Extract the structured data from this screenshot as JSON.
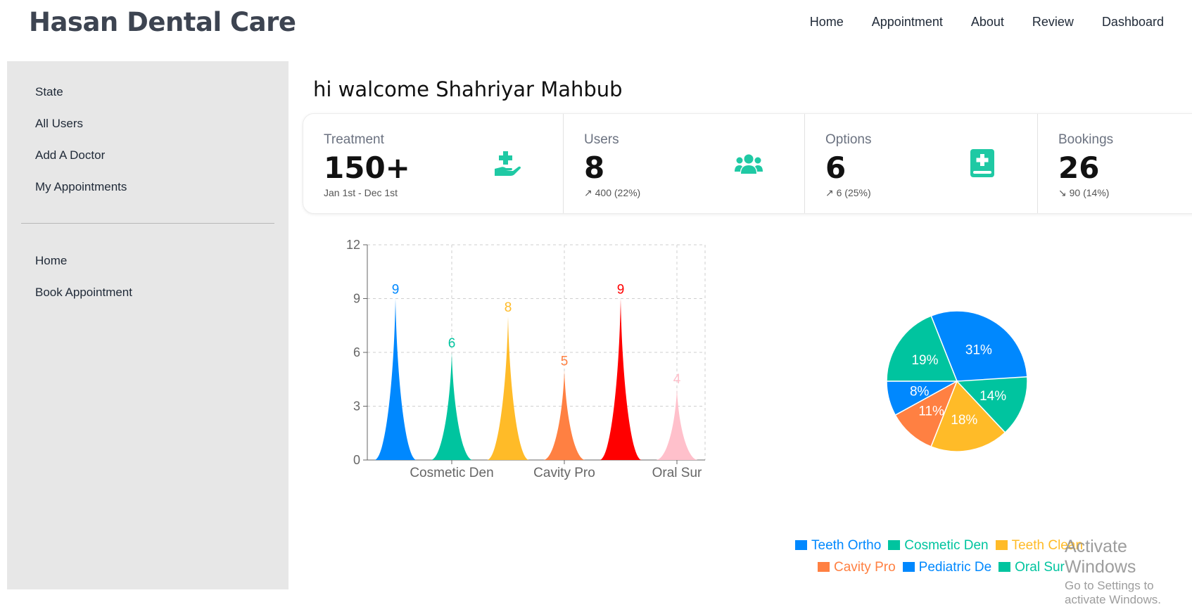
{
  "header": {
    "brand": "Hasan Dental Care",
    "nav": [
      "Home",
      "Appointment",
      "About",
      "Review",
      "Dashboard"
    ]
  },
  "sidebar": {
    "items_top": [
      "State",
      "All Users",
      "Add A Doctor",
      "My Appointments"
    ],
    "items_bottom": [
      "Home",
      "Book Appointment"
    ]
  },
  "main": {
    "welcome": "hi walcome Shahriyar Mahbub",
    "stats": [
      {
        "title": "Treatment",
        "value": "150+",
        "desc": "Jan 1st - Dec 1st",
        "icon": "hand-holding-medical-icon"
      },
      {
        "title": "Users",
        "value": "8",
        "desc": "↗ 400 (22%)",
        "icon": "users-icon"
      },
      {
        "title": "Options",
        "value": "6",
        "desc": "↗ 6 (25%)",
        "icon": "medical-book-icon"
      },
      {
        "title": "Bookings",
        "value": "26",
        "desc": "↘ 90 (14%)",
        "icon": "arrow-down-right-icon"
      }
    ],
    "accent_color": "#1fc9a4"
  },
  "chart_data": [
    {
      "type": "bar",
      "categories": [
        "Teeth Ortho",
        "Cosmetic Den",
        "Teeth Clean",
        "Cavity Pro",
        "Pediatric De",
        "Oral Sur"
      ],
      "tick_labels_shown": [
        "Cosmetic Den",
        "Cavity Pro",
        "Oral Sur"
      ],
      "values": [
        9,
        6,
        8,
        5,
        9,
        4
      ],
      "colors": [
        "#0088FE",
        "#00C49F",
        "#FFBB28",
        "#FF8042",
        "#FF0000",
        "#FFC0CB"
      ],
      "ylim": [
        0,
        12
      ],
      "yticks": [
        0,
        3,
        6,
        9,
        12
      ],
      "grid": true,
      "shape": "triangle-peak"
    },
    {
      "type": "pie",
      "slices": [
        {
          "label": "Teeth Ortho",
          "percent": 31,
          "color": "#0088FE"
        },
        {
          "label": "Cosmetic Den",
          "percent": 19,
          "color": "#00C49F"
        },
        {
          "label": "Pediatric De",
          "percent": 8,
          "color": "#0088FE"
        },
        {
          "label": "Cavity Pro",
          "percent": 11,
          "color": "#FF8042"
        },
        {
          "label": "Teeth Clean",
          "percent": 18,
          "color": "#FFBB28"
        },
        {
          "label": "Oral Sur",
          "percent": 14,
          "color": "#00C49F"
        }
      ],
      "legend": [
        [
          {
            "label": "Teeth Ortho",
            "color": "#0088FE"
          },
          {
            "label": "Cosmetic Den",
            "color": "#00C49F"
          },
          {
            "label": "Teeth Clean",
            "color": "#FFBB28"
          }
        ],
        [
          {
            "label": "Cavity Pro",
            "color": "#FF8042"
          },
          {
            "label": "Pediatric De",
            "color": "#0088FE"
          },
          {
            "label": "Oral Sur",
            "color": "#00C49F"
          }
        ]
      ],
      "legend_position": "bottom-right"
    }
  ],
  "watermark": {
    "title": "Activate Windows",
    "subtitle": "Go to Settings to activate Windows."
  }
}
